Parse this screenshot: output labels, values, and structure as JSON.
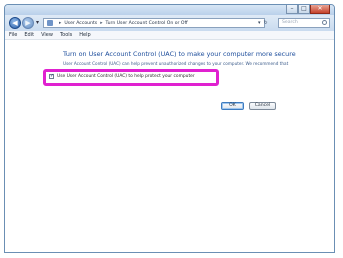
{
  "window": {
    "controls": {
      "minimize": "–",
      "maximize": "□",
      "close": "✕"
    }
  },
  "address_bar": {
    "back_glyph": "◀",
    "forward_glyph": "▶",
    "recent_glyph": "▾",
    "breadcrumbs": [
      "User Accounts",
      "Turn User Account Control On or Off"
    ],
    "separator": "▸",
    "dropdown_glyph": "▾",
    "refresh_glyph": "↻",
    "search_placeholder": "Search"
  },
  "menu": {
    "items": [
      "File",
      "Edit",
      "View",
      "Tools",
      "Help"
    ]
  },
  "main": {
    "heading": "Turn on User Account Control (UAC) to make your computer more secure",
    "description": "User Account Control (UAC) can help prevent unauthorized changes to your computer.  We recommend that",
    "checkbox": {
      "label": "Use User Account Control (UAC) to help protect your computer",
      "checked_glyph": "✓"
    },
    "ok_label": "OK",
    "cancel_label": "Cancel"
  },
  "colors": {
    "highlight": "#e021d0",
    "heading": "#1e4e9c"
  }
}
